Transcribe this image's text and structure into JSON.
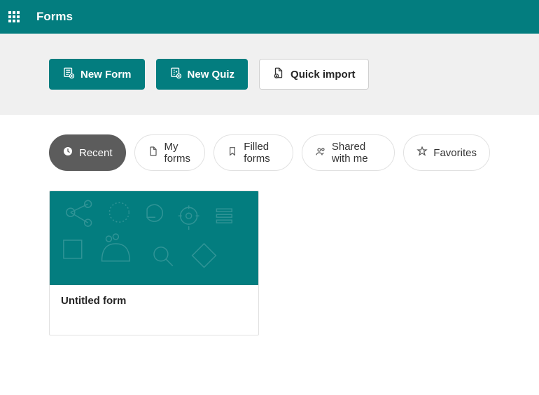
{
  "header": {
    "app_title": "Forms"
  },
  "actions": {
    "new_form": "New Form",
    "new_quiz": "New Quiz",
    "quick_import": "Quick import"
  },
  "filters": {
    "recent": "Recent",
    "my_forms": "My forms",
    "filled_forms": "Filled forms",
    "shared_with_me": "Shared with me",
    "favorites": "Favorites"
  },
  "cards": [
    {
      "title": "Untitled form"
    }
  ],
  "colors": {
    "brand": "#037d7f"
  }
}
